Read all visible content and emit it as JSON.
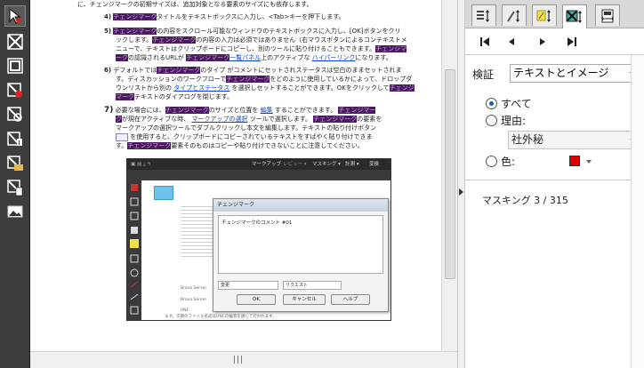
{
  "toolbar": {
    "tools": [
      {
        "icon": "redact-arrow-icon",
        "active": true
      },
      {
        "icon": "redact-box-icon"
      },
      {
        "icon": "redact-frame-icon"
      },
      {
        "icon": "redact-user-icon"
      },
      {
        "icon": "redact-search-icon"
      },
      {
        "icon": "redact-text-icon"
      },
      {
        "icon": "redact-folder-icon"
      },
      {
        "icon": "redact-page-icon"
      },
      {
        "icon": "image-icon"
      }
    ]
  },
  "document": {
    "line0": "に、チェンジマークの初期サイズは、追加対象となる要素のサイズにも依存します。",
    "line1_num": "4)",
    "line1_hl": "チェンジマーク",
    "line1_text": "タイトルをテキストボックスに入力し、<Tab>キーを押下します。",
    "item5_num": "5)",
    "item5_hl1": "チェンジマーク",
    "item5_t1": "の内容をスクロール可能なウィンドウのテキストボックスに入力し、[OK]ボタンをクリ",
    "item5_t2": "ックします。",
    "item5_hl2": "チェンジマーク",
    "item5_t3": "の内容の入力は必須ではありません（右マウスボタンによるコンテキストメ",
    "item5_t4": "ニューで、テキストはクリップボードにコピーし、別のツールに貼り付けることもできます。",
    "item5_hl3": "チェンジマ",
    "item5_hl4": "ーク",
    "item5_t5": "の認識されるURLが",
    "item5_hl5": "チェンジマーク",
    "item5_link1": "一覧パネル",
    "item5_t6": "上のアクティブな",
    "item5_link2": "ハイパーリンク",
    "item5_t7": "になります。",
    "item6_num": "6)",
    "item6_t1": "デフォルトでは",
    "item6_hl1": "チェンジマーク",
    "item6_t2": "のタイプ",
    "item6_t3": "がコメントにセットされステータスは空白のままセットされま",
    "item6_t4": "す。ディスカッションのワークフローで",
    "item6_hl2": "チェンジマーク",
    "item6_t5": "をどのように使用しているかによって、ドロップダ",
    "item6_t6": "ウンリストから別の",
    "item6_link": "タイプとステータス",
    "item6_t7": "を選択しセットすることができます。OKをクリックして",
    "item6_hl3": "チェンジ",
    "item6_hl4": "マーク",
    "item6_t8": "テキストのダイアログを閉じます。",
    "item7_num": "7)",
    "item7_t1": "必要な場合には、",
    "item7_hl1": "チェンジマーク",
    "item7_t2": "のサイズと位置を",
    "item7_link1": "編集",
    "item7_t3": "することができます。",
    "item7_hl2": "チェンジマー",
    "item7_hl3": "ク",
    "item7_t4": "が現在アクティブな時、",
    "item7_link2": "マークアップの選択",
    "item7_t5": "ツールで選択します。",
    "item7_hl4": "チェンジマーク",
    "item7_t6": "の要素を",
    "item7_t7": "マークアップの選択ツールでダブルクリックし本文を編集します。テキストの貼り付けボタン",
    "item7_t8": "を使用すると、クリップボードにコピーされているテキストをすばやく貼り付けできま",
    "item7_t9": "す。",
    "item7_hl5": "チェンジマーク",
    "item7_t10": "要素そのものはコピーや貼り付けできないことに注意してください。"
  },
  "embedded": {
    "menu_markup": "マークアップ",
    "menu_review": "レビュー ▾",
    "menu_masking": "マスキング ▾",
    "menu_measure": "計測 ▾",
    "menu_convert": "変換",
    "dialog_title": "チェンジマーク",
    "dialog_comment": "チェンジマークのコメント #01",
    "type_value": "変更",
    "status_value": "リクエスト",
    "ok_label": "OK",
    "cancel_label": "キャンセル",
    "help_label": "ヘルプ",
    "bg_text1": "Brava Server",
    "bg_text2": "Brava Server",
    "bg_text3": "UNC",
    "bg_text4": "ます。次節のファイル名前はUNCの輪郭を通じて行われます。"
  },
  "scrollbar": {
    "grip": "|||"
  },
  "panel": {
    "tabs": [
      {
        "icon": "list-sort-icon"
      },
      {
        "icon": "pen-sort-icon"
      },
      {
        "icon": "note-sort-icon"
      },
      {
        "icon": "masking-image-icon",
        "active": true
      },
      {
        "icon": "fit-width-icon"
      }
    ],
    "nav": {
      "first": "first-page-icon",
      "prev": "prev-page-icon",
      "next": "next-page-icon",
      "last": "last-page-icon"
    },
    "verify_label": "検証",
    "verify_value": "テキストとイメージ",
    "radio_all": "すべて",
    "radio_reason": "理由:",
    "reason_value": "社外秘",
    "radio_color": "色:",
    "color_value": "#e00000",
    "masking_count": "マスキング 3 / 315"
  }
}
